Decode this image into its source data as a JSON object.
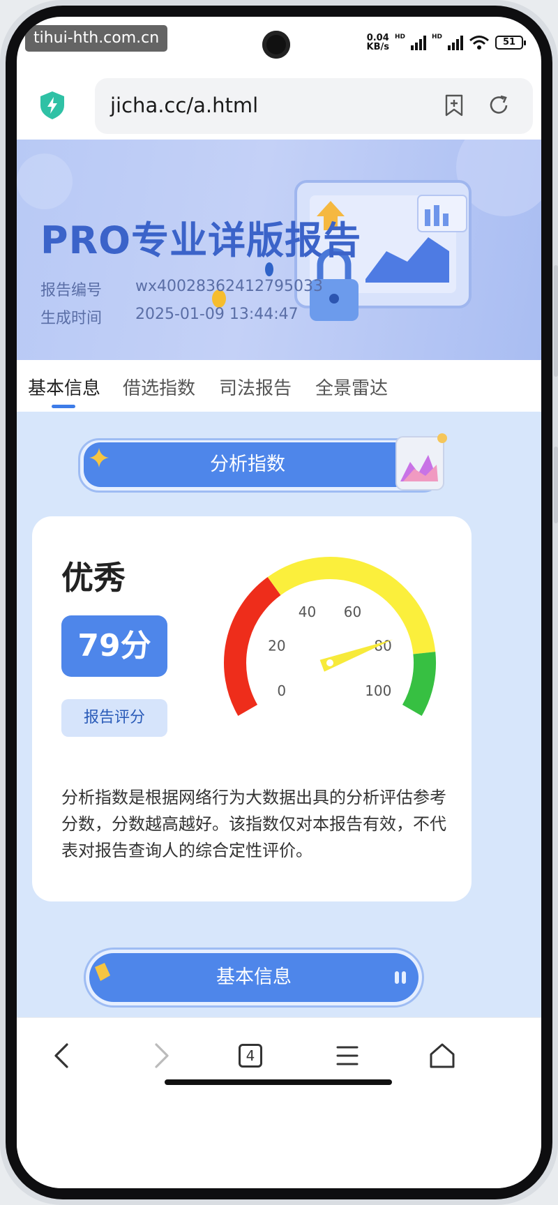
{
  "watermark": "tihui-hth.com.cn",
  "status": {
    "net_speed_value": "0.04",
    "net_speed_unit": "KB/s",
    "hd": "HD",
    "battery": "51"
  },
  "browser": {
    "url": "jicha.cc/a.html",
    "tab_count": "4"
  },
  "hero": {
    "title": "PRO专业详版报告",
    "report_no_label": "报告编号",
    "report_no": "wx40028362412795033",
    "time_label": "生成时间",
    "time": "2025-01-09 13:44:47"
  },
  "tabs": [
    {
      "label": "基本信息",
      "active": true
    },
    {
      "label": "借选指数",
      "active": false
    },
    {
      "label": "司法报告",
      "active": false
    },
    {
      "label": "全景雷达",
      "active": false
    }
  ],
  "section_title": "分析指数",
  "score": {
    "grade": "优秀",
    "value": "79分",
    "label": "报告评分",
    "gauge_value": 79,
    "gauge_ticks": [
      "0",
      "20",
      "40",
      "60",
      "80",
      "100"
    ],
    "colors": {
      "red": "#ee2d1b",
      "yellow": "#fbef3c",
      "green": "#37c042"
    }
  },
  "description": "分析指数是根据网络行为大数据出具的分析评估参考分数，分数越高越好。该指数仅对本报告有效，不代表对报告查询人的综合定性评价。",
  "next_section": "基本信息",
  "icons": [
    "shield-icon",
    "bookmark-add-icon",
    "refresh-icon",
    "back-icon",
    "forward-icon",
    "tabs-icon",
    "menu-icon",
    "home-icon"
  ]
}
